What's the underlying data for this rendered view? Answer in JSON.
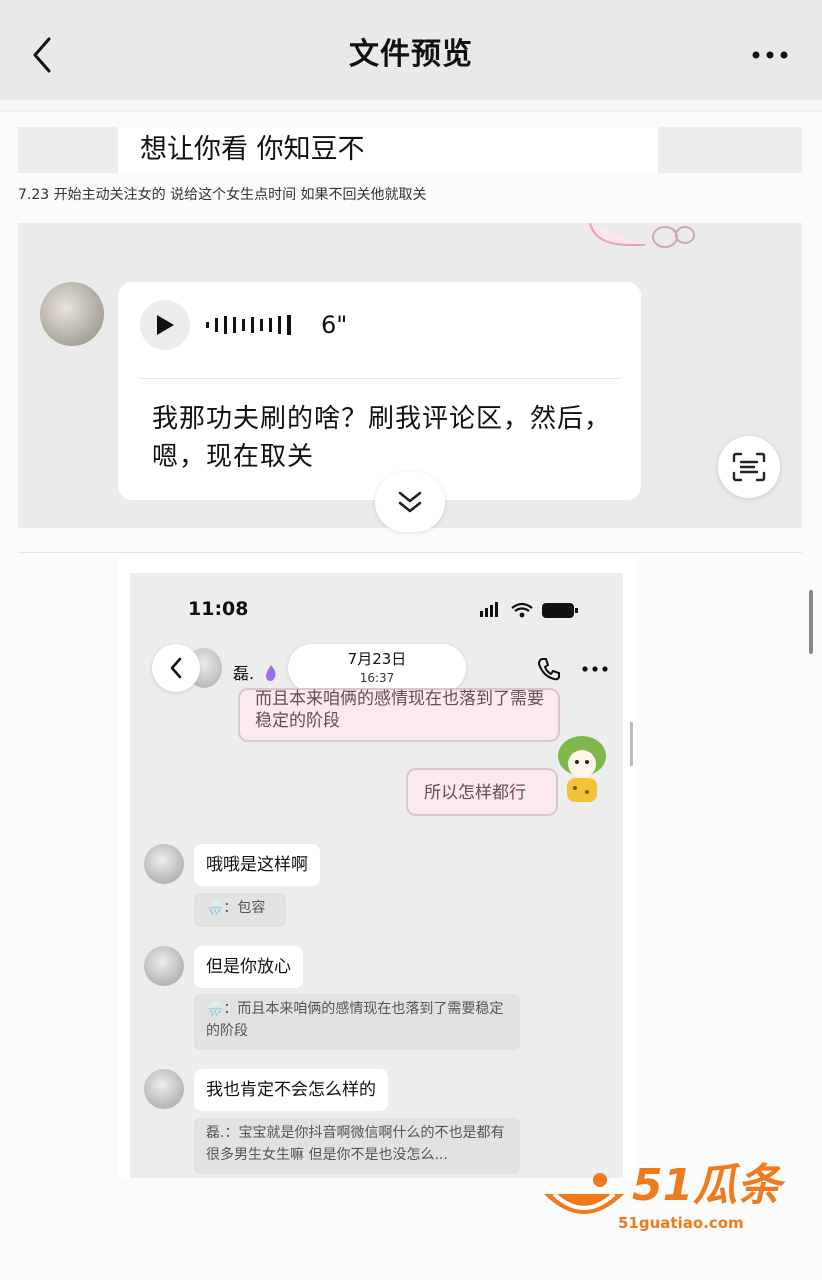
{
  "header": {
    "title": "文件预览"
  },
  "document": {
    "caption": "想让你看 你知豆不",
    "note": "7.23 开始主动关注女的 说给这个女生点时间 如果不回关他就取关",
    "voice": {
      "duration": "6\"",
      "transcript": "我那功夫刷的啥？刷我评论区，然后，嗯，现在取关"
    }
  },
  "screenshot": {
    "status_time": "11:08",
    "contact_name": "磊.",
    "date": "7月23日",
    "time": "16:37",
    "sent": [
      {
        "text": "而且本来咱俩的感情现在也落到了需要稳定的阶段"
      },
      {
        "text": "所以怎样都行"
      }
    ],
    "received": [
      {
        "text": "哦哦是这样啊",
        "quote": "🌧️：包容"
      },
      {
        "text": "但是你放心",
        "quote": "🌧️：而且本来咱俩的感情现在也落到了需要稳定的阶段"
      },
      {
        "text": "我也肯定不会怎么样的",
        "quote": "磊.：宝宝就是你抖音啊微信啊什么的不也是都有很多男生女生嘛 但是你不是也没怎么..."
      }
    ]
  },
  "watermark": {
    "brand": "51瓜条",
    "url": "51guatiao.com"
  },
  "colors": {
    "accent_orange": "#f07a1e",
    "pink_bubble": "#fbe9ef"
  }
}
